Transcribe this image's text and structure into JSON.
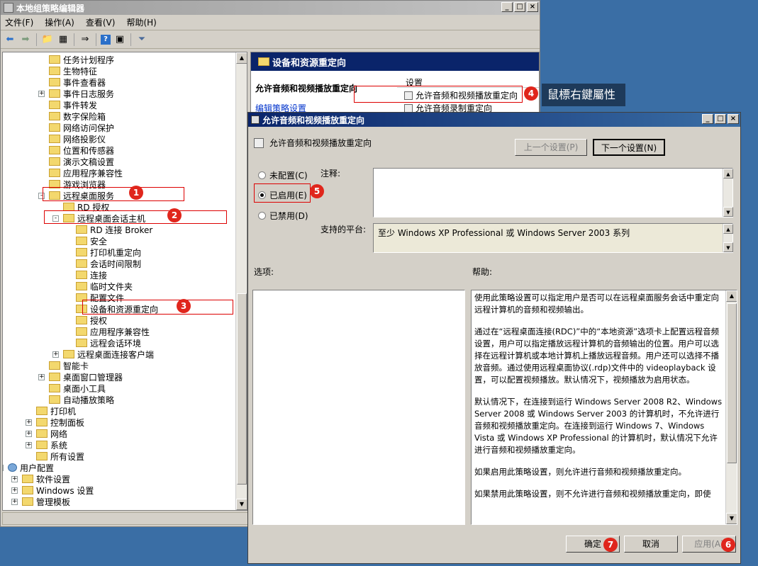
{
  "window": {
    "title": "本地组策略编辑器",
    "controls": [
      "_",
      "□",
      "×"
    ]
  },
  "menu": [
    "文件(F)",
    "操作(A)",
    "查看(V)",
    "帮助(H)"
  ],
  "toolbar_icons": [
    "back-arrow-icon",
    "forward-arrow-icon",
    "up-folder-icon",
    "show-hide-tree-icon",
    "export-list-icon",
    "help-icon",
    "properties-icon",
    "filter-icon"
  ],
  "tree": [
    {
      "label": "任务计划程序",
      "level": 4,
      "expand": ""
    },
    {
      "label": "生物特征",
      "level": 4,
      "expand": ""
    },
    {
      "label": "事件查看器",
      "level": 4,
      "expand": ""
    },
    {
      "label": "事件日志服务",
      "level": 4,
      "expand": "+"
    },
    {
      "label": "事件转发",
      "level": 4,
      "expand": ""
    },
    {
      "label": "数字保险箱",
      "level": 4,
      "expand": ""
    },
    {
      "label": "网络访问保护",
      "level": 4,
      "expand": ""
    },
    {
      "label": "网络投影仪",
      "level": 4,
      "expand": ""
    },
    {
      "label": "位置和传感器",
      "level": 4,
      "expand": ""
    },
    {
      "label": "演示文稿设置",
      "level": 4,
      "expand": ""
    },
    {
      "label": "应用程序兼容性",
      "level": 4,
      "expand": ""
    },
    {
      "label": "游戏浏览器",
      "level": 4,
      "expand": ""
    },
    {
      "label": "远程桌面服务",
      "level": 4,
      "expand": "-"
    },
    {
      "label": "RD 授权",
      "level": 5,
      "expand": ""
    },
    {
      "label": "远程桌面会话主机",
      "level": 5,
      "expand": "-"
    },
    {
      "label": "RD 连接 Broker",
      "level": 6,
      "expand": ""
    },
    {
      "label": "安全",
      "level": 6,
      "expand": ""
    },
    {
      "label": "打印机重定向",
      "level": 6,
      "expand": ""
    },
    {
      "label": "会话时间限制",
      "level": 6,
      "expand": ""
    },
    {
      "label": "连接",
      "level": 6,
      "expand": ""
    },
    {
      "label": "临时文件夹",
      "level": 6,
      "expand": ""
    },
    {
      "label": "配置文件",
      "level": 6,
      "expand": ""
    },
    {
      "label": "设备和资源重定向",
      "level": 6,
      "expand": ""
    },
    {
      "label": "授权",
      "level": 6,
      "expand": ""
    },
    {
      "label": "应用程序兼容性",
      "level": 6,
      "expand": ""
    },
    {
      "label": "远程会话环境",
      "level": 6,
      "expand": ""
    },
    {
      "label": "远程桌面连接客户端",
      "level": 5,
      "expand": "+"
    },
    {
      "label": "智能卡",
      "level": 4,
      "expand": ""
    },
    {
      "label": "桌面窗口管理器",
      "level": 4,
      "expand": "+"
    },
    {
      "label": "桌面小工具",
      "level": 4,
      "expand": ""
    },
    {
      "label": "自动播放策略",
      "level": 4,
      "expand": ""
    },
    {
      "label": "打印机",
      "level": 3,
      "expand": ""
    },
    {
      "label": "控制面板",
      "level": 3,
      "expand": "+"
    },
    {
      "label": "网络",
      "level": 3,
      "expand": "+"
    },
    {
      "label": "系统",
      "level": 3,
      "expand": "+"
    },
    {
      "label": "所有设置",
      "level": 3,
      "expand": ""
    },
    {
      "label": "用户配置",
      "level": 1,
      "expand": "-"
    },
    {
      "label": "软件设置",
      "level": 2,
      "expand": "+"
    },
    {
      "label": "Windows 设置",
      "level": 2,
      "expand": "+"
    },
    {
      "label": "管理模板",
      "level": 2,
      "expand": "+"
    }
  ],
  "right_pane": {
    "header": "设备和资源重定向",
    "policy_title": "允许音频和视频播放重定向",
    "edit_link": "编辑策略设置",
    "col_header": "设置",
    "items": [
      "允许音频和视频播放重定向",
      "允许音频录制重定向"
    ]
  },
  "tooltip": "鼠標右鍵屬性",
  "badges": [
    "1",
    "2",
    "3",
    "4",
    "5",
    "6",
    "7"
  ],
  "dialog": {
    "title": "允许音频和视频播放重定向",
    "policy_name": "允许音频和视频播放重定向",
    "prev_btn": "上一个设置(P)",
    "next_btn": "下一个设置(N)",
    "radio_not_configured": "未配置(C)",
    "radio_enabled": "已启用(E)",
    "radio_disabled": "已禁用(D)",
    "comment_label": "注释:",
    "platform_label": "支持的平台:",
    "platform_value": "至少 Windows XP Professional 或 Windows Server 2003 系列",
    "options_label": "选项:",
    "help_label": "帮助:",
    "help_paragraphs": [
      "使用此策略设置可以指定用户是否可以在远程桌面服务会话中重定向远程计算机的音频和视频输出。",
      "通过在“远程桌面连接(RDC)”中的“本地资源”选项卡上配置远程音频设置，用户可以指定播放远程计算机的音频输出的位置。用户可以选择在远程计算机或本地计算机上播放远程音频。用户还可以选择不播放音频。通过使用远程桌面协议(.rdp)文件中的 videoplayback 设置，可以配置视频播放。默认情况下，视频播放为启用状态。",
      "默认情况下，在连接到运行 Windows Server 2008 R2、Windows Server 2008 或 Windows Server 2003 的计算机时，不允许进行音频和视频播放重定向。在连接到运行 Windows 7、Windows Vista 或 Windows XP Professional 的计算机时，默认情况下允许进行音频和视频播放重定向。",
      "如果启用此策略设置，则允许进行音频和视频播放重定向。",
      "如果禁用此策略设置，则不允许进行音频和视频播放重定向，即使"
    ],
    "ok_btn": "确定",
    "cancel_btn": "取消",
    "apply_btn": "应用(A)"
  }
}
